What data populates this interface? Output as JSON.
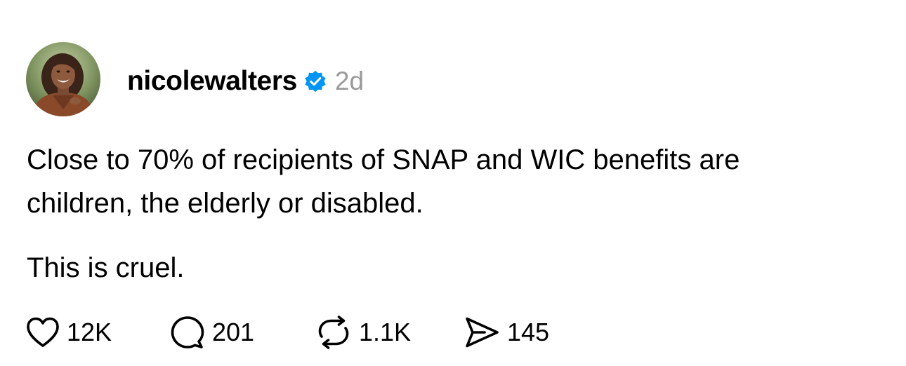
{
  "post": {
    "author": {
      "username": "nicolewalters",
      "verified": true,
      "avatar_icon": "profile-photo"
    },
    "timestamp": "2d",
    "body": {
      "paragraphs": [
        [
          "Close to 70% of recipients of SNAP and WIC benefits are",
          "children, the elderly or disabled."
        ],
        [
          "This is cruel."
        ]
      ],
      "line1": "Close to 70% of recipients of SNAP and WIC benefits are",
      "line2": "children, the elderly or disabled.",
      "line3": "This is cruel."
    },
    "actions": {
      "likes": "12K",
      "replies": "201",
      "reposts": "1.1K",
      "shares": "145"
    },
    "icons": {
      "like": "heart-icon",
      "reply": "comment-bubble-icon",
      "repost": "repost-icon",
      "share": "send-icon",
      "verified": "verified-badge-icon"
    },
    "colors": {
      "verified_blue": "#0095F6",
      "timestamp_gray": "#999999",
      "text": "#000000"
    }
  }
}
